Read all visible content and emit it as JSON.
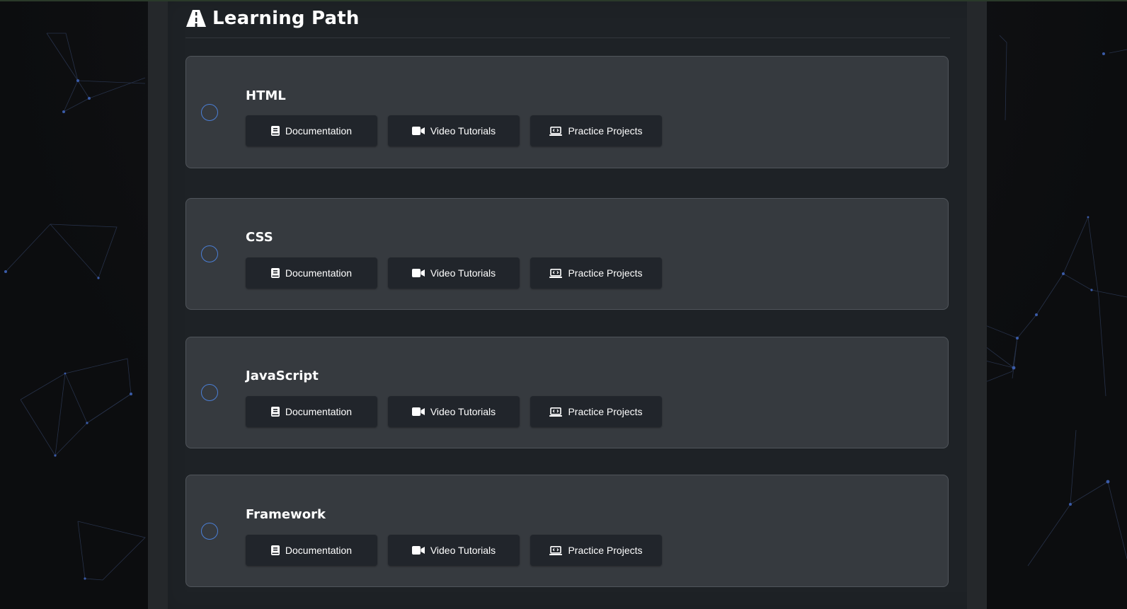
{
  "page": {
    "title": "Learning Path",
    "title_icon": "road-icon"
  },
  "steps": [
    {
      "title": "HTML",
      "completed": false,
      "buttons": [
        {
          "label": "Documentation",
          "icon": "book-icon"
        },
        {
          "label": "Video Tutorials",
          "icon": "video-icon"
        },
        {
          "label": "Practice Projects",
          "icon": "laptop-code-icon"
        }
      ]
    },
    {
      "title": "CSS",
      "completed": false,
      "buttons": [
        {
          "label": "Documentation",
          "icon": "book-icon"
        },
        {
          "label": "Video Tutorials",
          "icon": "video-icon"
        },
        {
          "label": "Practice Projects",
          "icon": "laptop-code-icon"
        }
      ]
    },
    {
      "title": "JavaScript",
      "completed": false,
      "buttons": [
        {
          "label": "Documentation",
          "icon": "book-icon"
        },
        {
          "label": "Video Tutorials",
          "icon": "video-icon"
        },
        {
          "label": "Practice Projects",
          "icon": "laptop-code-icon"
        }
      ]
    },
    {
      "title": "Framework",
      "completed": false,
      "buttons": [
        {
          "label": "Documentation",
          "icon": "book-icon"
        },
        {
          "label": "Video Tutorials",
          "icon": "video-icon"
        },
        {
          "label": "Practice Projects",
          "icon": "laptop-code-icon"
        }
      ]
    }
  ],
  "colors": {
    "accent": "#4b7fd6",
    "card_bg": "#363a3f",
    "button_bg": "#21252b",
    "panel_bg": "#1e2226"
  }
}
